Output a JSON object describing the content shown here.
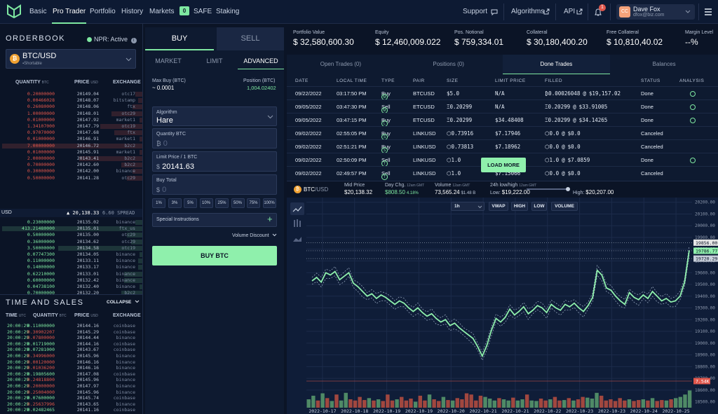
{
  "nav": {
    "items": [
      "Basic",
      "Pro Trader",
      "Portfolio",
      "History",
      "Markets"
    ],
    "safe_badge": "0",
    "safe_label": "SAFE",
    "staking": "Staking",
    "support": "Support",
    "algorithms": "Algorithms",
    "api": "API",
    "notif_count": "1",
    "user_name": "Dave Fox",
    "user_email": "dfox@biz.com",
    "user_initials": "CC"
  },
  "orderbook": {
    "title": "ORDERBOOK",
    "npr": "NPR: Active",
    "pair": "BTC/USD",
    "pair_sub": "▪Shortable",
    "coin": "₿",
    "col_qty": "QUANTITY",
    "col_qty_unit": "BTC",
    "col_price": "PRICE",
    "col_price_unit": "USD",
    "col_exchange": "EXCHANGE",
    "asks": [
      [
        "0.20000000",
        "20149.04",
        "otc17",
        0.05
      ],
      [
        "0.00466028",
        "20148.07",
        "bitstamp",
        0.03
      ],
      [
        "0.26080000",
        "20148.06",
        "ftx",
        0.07
      ],
      [
        "1.00000000",
        "20148.01",
        "otc29",
        0.22
      ],
      [
        "0.01000000",
        "20147.92",
        "market1",
        0.02
      ],
      [
        "1.34107000",
        "20147.79",
        "otc19",
        0.3
      ],
      [
        "0.97070000",
        "20147.68",
        "ftx",
        0.2
      ],
      [
        "0.01000000",
        "20146.91",
        "market1",
        0.02
      ],
      [
        "7.00000000",
        "20146.72",
        "b2c2",
        1.0
      ],
      [
        "0.01000000",
        "20145.91",
        "market1",
        0.02
      ],
      [
        "2.00000000",
        "20143.41",
        "b2c2",
        0.45
      ],
      [
        "0.70000000",
        "20142.60",
        "b2c2",
        0.15
      ],
      [
        "0.30000000",
        "20142.00",
        "binance",
        0.07
      ],
      [
        "0.50000000",
        "20141.28",
        "otc29",
        0.11
      ]
    ],
    "mid_label": "USD",
    "mid_price": "▲ 20,138.33",
    "spread": "6.60 SPREAD",
    "bids": [
      [
        "0.23000000",
        "20135.02",
        "binance",
        0.05
      ],
      [
        "413.21480000",
        "20135.01",
        "ftx_us",
        1.0
      ],
      [
        "0.50000000",
        "20135.00",
        "otc29",
        0.11
      ],
      [
        "0.36000000",
        "20134.62",
        "otc29",
        0.08
      ],
      [
        "3.50000000",
        "20134.58",
        "otc19",
        0.6
      ],
      [
        "0.07747300",
        "20134.05",
        "binance",
        0.02
      ],
      [
        "0.11000000",
        "20133.11",
        "binance",
        0.03
      ],
      [
        "0.14000000",
        "20133.17",
        "binance",
        0.03
      ],
      [
        "0.62210000",
        "20133.01",
        "binance",
        0.13
      ],
      [
        "0.60000000",
        "20132.42",
        "binance",
        0.13
      ],
      [
        "0.04738100",
        "20132.40",
        "binance",
        0.02
      ],
      [
        "0.70000000",
        "20132.20",
        "b2c2",
        0.15
      ],
      [
        "1.24155000",
        "20131.91",
        "otc19",
        0.27
      ],
      [
        "0.10000000",
        "20131.91",
        "b2c2",
        0.03
      ]
    ]
  },
  "tas": {
    "title": "TIME AND SALES",
    "collapse": "COLLAPSE",
    "col_time": "TIME",
    "col_time_unit": "UTC",
    "col_qty": "QUANTITY",
    "col_qty_unit": "BTC",
    "col_price": "PRICE",
    "col_price_unit": "USD",
    "col_exchange": "EXCHANGE",
    "rows": [
      [
        "20:00:29",
        "0.11000000",
        "20144.16",
        "coinbase",
        "buy"
      ],
      [
        "20:00:29",
        "0.30902207",
        "20145.29",
        "coinbase",
        "sell"
      ],
      [
        "20:00:29",
        "0.07800000",
        "20144.44",
        "binance",
        "sell"
      ],
      [
        "20:00:29",
        "0.01719000",
        "20144.16",
        "coinbase",
        "buy"
      ],
      [
        "20:00:29",
        "0.07281000",
        "20143.67",
        "coinbase",
        "buy"
      ],
      [
        "20:00:29",
        "0.34996000",
        "20145.96",
        "binance",
        "sell"
      ],
      [
        "20:00:29",
        "0.00120000",
        "20146.16",
        "binance",
        "sell"
      ],
      [
        "20:00:29",
        "0.01036200",
        "20146.16",
        "binance",
        "sell"
      ],
      [
        "20:00:29",
        "0.19805600",
        "20147.08",
        "coinbase",
        "buy"
      ],
      [
        "20:00:29",
        "0.24818800",
        "20145.96",
        "binance",
        "sell"
      ],
      [
        "20:00:29",
        "0.20000000",
        "20147.97",
        "binance",
        "sell"
      ],
      [
        "20:00:29",
        "0.25004000",
        "20145.96",
        "binance",
        "sell"
      ],
      [
        "20:00:29",
        "0.07600000",
        "20145.74",
        "coinbase",
        "buy"
      ],
      [
        "20:00:29",
        "0.25637996",
        "20143.65",
        "binance",
        "sell"
      ],
      [
        "20:00:29",
        "0.02482465",
        "20141.16",
        "coinbase",
        "buy"
      ]
    ]
  },
  "trade": {
    "buy": "BUY",
    "sell": "SELL",
    "market": "MARKET",
    "limit": "LIMIT",
    "advanced": "ADVANCED",
    "max_buy_label": "Max Buy (BTC)",
    "max_buy_value": "~ 0.0001",
    "position_label": "Position (BTC)",
    "position_value": "1,004.02402",
    "algo_label": "Algorithm",
    "algo_value": "Hare",
    "qty_label": "Quantity BTC",
    "qty_value": "0",
    "qty_prefix": "₿",
    "limit_label": "Limit Price / 1 BTC",
    "limit_value": "20141.63",
    "limit_prefix": "$",
    "total_label": "Buy Total",
    "total_value": "0",
    "total_prefix": "$",
    "percents": [
      "1%",
      "3%",
      "5%",
      "10%",
      "25%",
      "50%",
      "75%",
      "100%"
    ],
    "special": "Special Instructions",
    "volume_discount": "Volume Discount",
    "buy_button": "BUY BTC"
  },
  "stats": [
    {
      "label": "Portfolio Value",
      "value": "$ 32,580,600.30"
    },
    {
      "label": "Equity",
      "value": "$ 12,460,009.022"
    },
    {
      "label": "Pos. Notional",
      "value": "$ 759,334.01"
    },
    {
      "label": "Collateral",
      "value": "$ 30,180,400.20"
    },
    {
      "label": "Free Collateral",
      "value": "$ 10,810,40.02"
    },
    {
      "label": "Margin Level",
      "value": "--%"
    }
  ],
  "trades": {
    "tabs": [
      "Open Trades (0)",
      "Positions (0)",
      "Done Trades",
      "Balances"
    ],
    "headers": [
      "DATE",
      "LOCAL TIME",
      "TYPE",
      "PAIR",
      "SIZE",
      "LIMIT PRICE",
      "FILLED",
      "STATUS",
      "ANALYSIS"
    ],
    "rows": [
      [
        "09/22/2022",
        "03:17:50 PM",
        "M",
        "Buy",
        "BTCUSD",
        "$5.0",
        "N/A",
        "₿0.00026048",
        "@",
        "$19,157.02",
        "Done",
        true
      ],
      [
        "09/05/2022",
        "03:47:30 PM",
        "M",
        "Sell",
        "ETCUSD",
        "Ξ0.20299",
        "N/A",
        "Ξ0.20299",
        "@",
        "$33.91005",
        "Done",
        true
      ],
      [
        "09/05/2022",
        "03:47:15 PM",
        "L",
        "Buy",
        "ETCUSD",
        "Ξ0.20299",
        "$34.48408",
        "Ξ0.20299",
        "@",
        "$34.14265",
        "Done",
        true
      ],
      [
        "09/02/2022",
        "02:55:05 PM",
        "S",
        "Buy",
        "LINKUSD",
        "⬡0.73916",
        "$7.17946",
        "⬡0.0",
        "@",
        "$0.0",
        "Canceled",
        false
      ],
      [
        "09/02/2022",
        "02:51:21 PM",
        "S",
        "Buy",
        "LINKUSD",
        "⬡0.73813",
        "$7.18962",
        "⬡0.0",
        "@",
        "$0.0",
        "Canceled",
        false
      ],
      [
        "09/02/2022",
        "02:50:09 PM",
        "T",
        "Sell",
        "LINKUSD",
        "⬡1.0",
        "",
        "⬡1.0",
        "@",
        "$7.0859",
        "Done",
        true
      ],
      [
        "09/02/2022",
        "02:49:57 PM",
        "T",
        "Sell",
        "LINKUSD",
        "⬡1.0",
        "$7.15066",
        "⬡0.0",
        "@",
        "$0.0",
        "Canceled",
        false
      ]
    ],
    "load_more": "LOAD MORE"
  },
  "chart_header": {
    "coin": "₿",
    "pair": "BTC",
    "pair_unit": "/USD",
    "mid_label": "Mid Price",
    "mid_value": "$20,138.32",
    "chg_label": "Day Chg.",
    "chg_unit": "12am GMT",
    "chg_value": "$808.50",
    "chg_pct": "4.18%",
    "vol_label": "Volume",
    "vol_unit": "12am GMT",
    "vol_value": "73,565.24",
    "vol_b": "$1.48 B",
    "hl_label": "24h low/high",
    "hl_unit": "12am GMT",
    "low_label": "Low:",
    "low_value": "$19,222.00",
    "high_label": "High:",
    "high_value": "$20,207.00",
    "interval": "1h",
    "buttons": [
      "VWAP",
      "HIGH",
      "LOW",
      "VOLUME"
    ]
  },
  "chart_data": {
    "type": "line",
    "title": "",
    "xlabel": "",
    "ylabel": "",
    "x_ticks": [
      "2022-10-17",
      "2022-10-18",
      "2022-10-19",
      "2022-10-19",
      "2022-10-20",
      "2022-10-21",
      "2022-10-21",
      "2022-10-22",
      "2022-10-23",
      "2022-10-23",
      "2022-10-24",
      "2022-10-25"
    ],
    "y_ticks": [
      18500,
      18600,
      18700,
      18800,
      18900,
      19000,
      19100,
      19200,
      19300,
      19400,
      19500,
      19600,
      19700,
      19800,
      19900,
      20000,
      20100,
      20200
    ],
    "ylim": [
      18450,
      20240
    ],
    "price_labels": [
      "19856.00",
      "19786.77",
      "19720.29"
    ],
    "volume_label": "7.54K",
    "series": [
      {
        "values": [
          19530,
          19560,
          19520,
          19600,
          19580,
          19610,
          19540,
          19570,
          19600,
          19510,
          19480,
          19440,
          19400,
          19420,
          19380,
          19410,
          19390,
          19360,
          19330,
          19360,
          19340,
          19300,
          19270,
          19300,
          19260,
          19230,
          19250,
          19210,
          19180,
          19200,
          19150,
          19170,
          19130,
          19100,
          19070,
          19040,
          18970,
          18890,
          18980,
          19110,
          19210,
          19180,
          19220,
          19290,
          19240,
          19270,
          19310,
          19250,
          19280,
          19320,
          19300,
          19260,
          19330,
          19300,
          19280,
          19330,
          19310,
          19340,
          19300,
          19270,
          19320,
          19390,
          19620,
          19580,
          19470,
          19450,
          19400,
          19360,
          19330,
          19430,
          19390,
          19370,
          19410,
          19380,
          19440,
          19400,
          19360,
          19380,
          19350,
          19360,
          19400,
          19520,
          19790
        ]
      }
    ],
    "volume": [
      0.35,
      0.5,
      0.3,
      0.6,
      0.4,
      0.28,
      0.55,
      0.3,
      0.62,
      0.35,
      0.3,
      0.45,
      0.32,
      0.4,
      0.3,
      0.35,
      0.28,
      0.55,
      0.3,
      0.35,
      0.45,
      0.3,
      0.38,
      0.25,
      0.5,
      0.3,
      0.55,
      0.35,
      0.28,
      0.45,
      0.32,
      0.3,
      0.4,
      0.35,
      0.6,
      0.55,
      0.3,
      0.5,
      0.45,
      0.38,
      0.3,
      0.4,
      0.35,
      0.3,
      0.42,
      0.3,
      0.35,
      0.55,
      0.3,
      0.28,
      0.38,
      0.3,
      0.35,
      0.45,
      0.3,
      0.32,
      0.4,
      0.3,
      0.35,
      0.45,
      0.42,
      0.38,
      0.62,
      0.5,
      0.3,
      0.35,
      0.28,
      0.4,
      0.3,
      0.35,
      0.28,
      0.32,
      0.35,
      0.3,
      0.4,
      0.28,
      0.32,
      0.3,
      0.35,
      0.4,
      0.45,
      0.55,
      0.72
    ]
  },
  "colors": {
    "accent": "#7ee8a1",
    "ask": "#e0564b",
    "bid": "#7ee8a1",
    "bg": "#0b1426",
    "panel": "#0e1a30"
  }
}
